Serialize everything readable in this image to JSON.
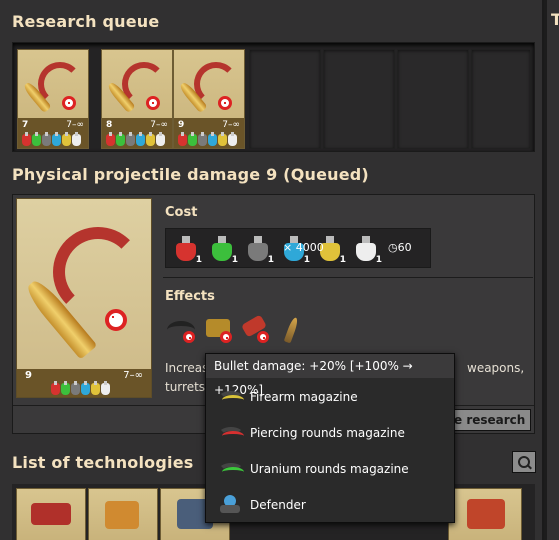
{
  "queue": {
    "title": "Research queue",
    "items": [
      {
        "level": "7",
        "range": "7–∞"
      },
      {
        "level": "8",
        "range": "7–∞"
      },
      {
        "level": "9",
        "range": "7–∞"
      }
    ]
  },
  "right_panel_title": "Te",
  "detail": {
    "title": "Physical projectile damage 9 (Queued)",
    "level": "9",
    "range": "7–∞",
    "cost_label": "Cost",
    "packs": [
      {
        "name": "automation-science-pack",
        "count": "1",
        "color": "#d6332f"
      },
      {
        "name": "logistic-science-pack",
        "count": "1",
        "color": "#3cbf3c"
      },
      {
        "name": "military-science-pack",
        "count": "1",
        "color": "#7a7a7a"
      },
      {
        "name": "chemical-science-pack",
        "count": "1",
        "color": "#2fa8d8"
      },
      {
        "name": "utility-science-pack",
        "count": "1",
        "color": "#e0c23a"
      },
      {
        "name": "space-science-pack",
        "count": "1",
        "color": "#eeeeee"
      }
    ],
    "time": "60",
    "multiplier": "× 4000",
    "effects_label": "Effects",
    "description_left": "Increas",
    "description_right": "weapons,",
    "description_line2": "turrets",
    "start_button": "e research"
  },
  "tooltip": {
    "header": "Bullet damage: +20% [+100% → +120%]",
    "items": [
      {
        "label": "Firearm magazine",
        "color": "#d8c23a"
      },
      {
        "label": "Piercing rounds magazine",
        "color": "#d63030"
      },
      {
        "label": "Uranium rounds magazine",
        "color": "#3cc83c"
      },
      {
        "label": "Defender",
        "color": "#4aa0d8"
      }
    ]
  },
  "technologies": {
    "title": "List of technologies"
  },
  "colors": {
    "accent_title": "#f4e2c0",
    "card_bg": "#d8c58f",
    "panel_bg": "#313031"
  }
}
